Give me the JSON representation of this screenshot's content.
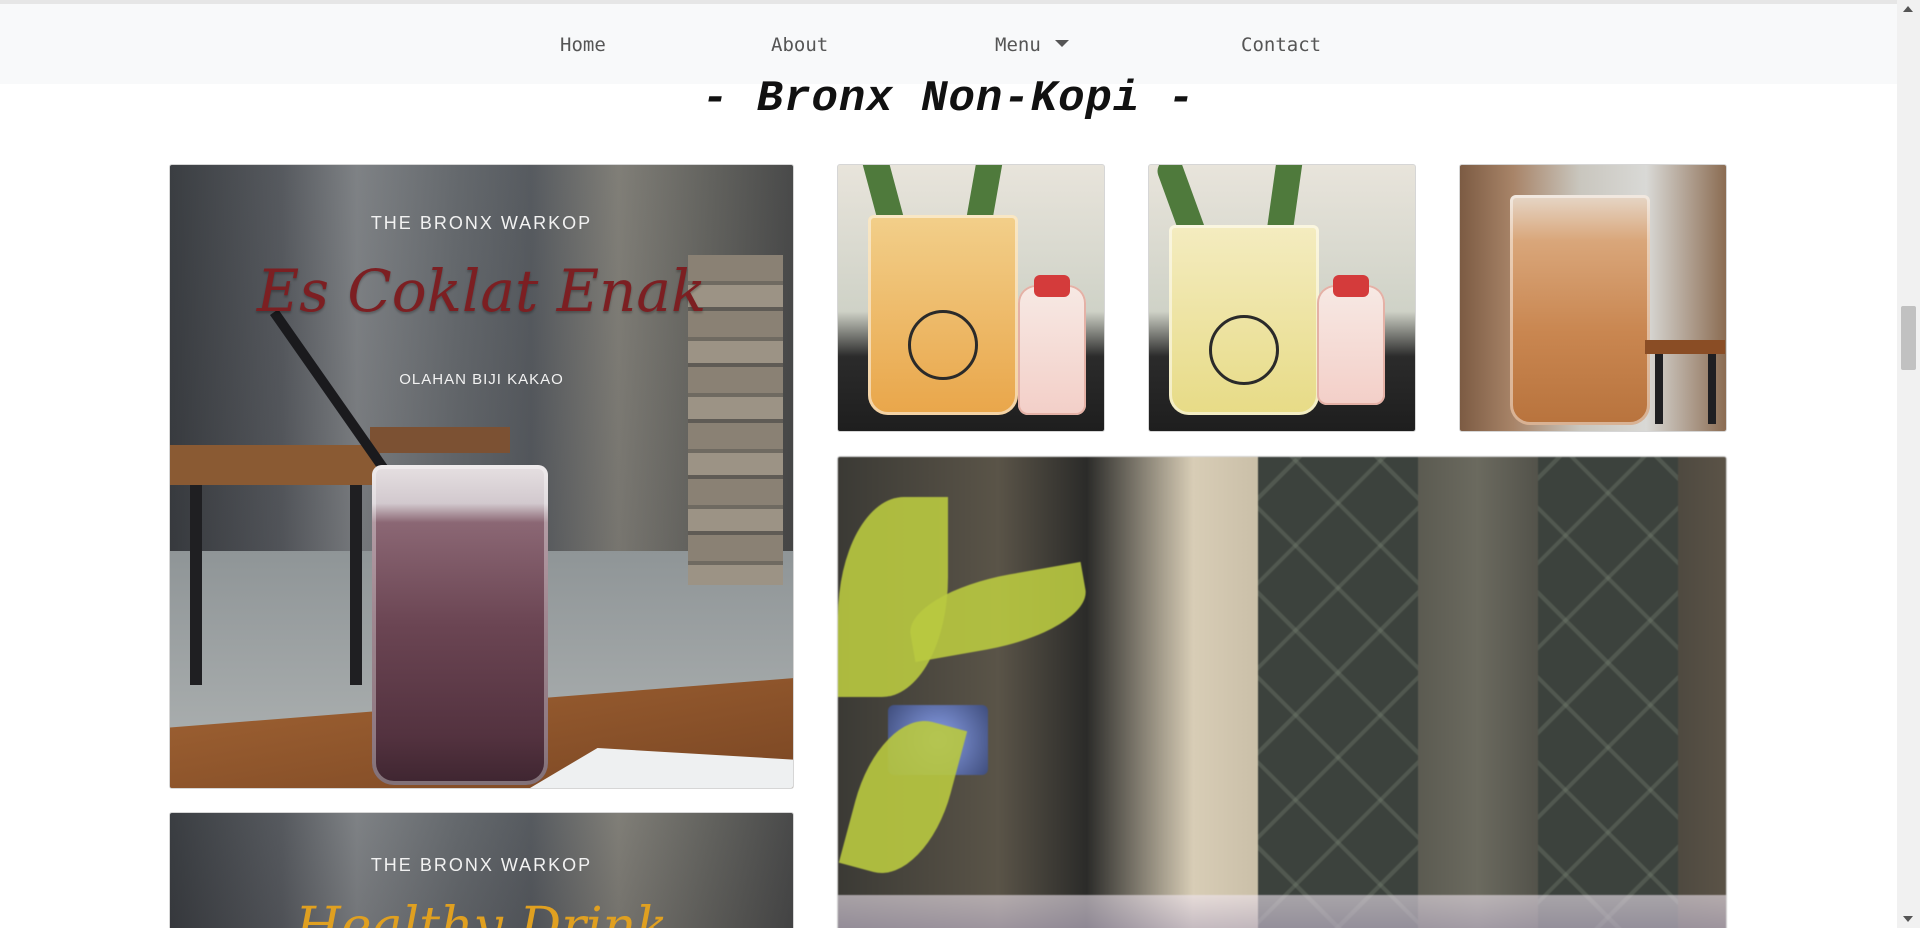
{
  "nav": {
    "items": [
      {
        "label": "Home"
      },
      {
        "label": "About"
      },
      {
        "label": "Menu",
        "has_dropdown": true
      },
      {
        "label": "Contact"
      }
    ]
  },
  "section": {
    "title": "- Bronx Non-Kopi -"
  },
  "cards": {
    "featured": {
      "brand": "THE BRONX WARKOP",
      "title": "Es Coklat Enak",
      "subtitle": "OLAHAN BIJI KAKAO"
    },
    "featured2": {
      "brand": "THE BRONX WARKOP",
      "title": "Healthy Drink"
    }
  },
  "colors": {
    "navbar_bg": "#f8f9fa",
    "title_script": "#7c1f22",
    "title_yellow": "#e0a020"
  },
  "icons": {
    "menu_dropdown": "caret-down-icon",
    "scroll_up": "scroll-up-arrow-icon",
    "scroll_down": "scroll-down-arrow-icon"
  }
}
